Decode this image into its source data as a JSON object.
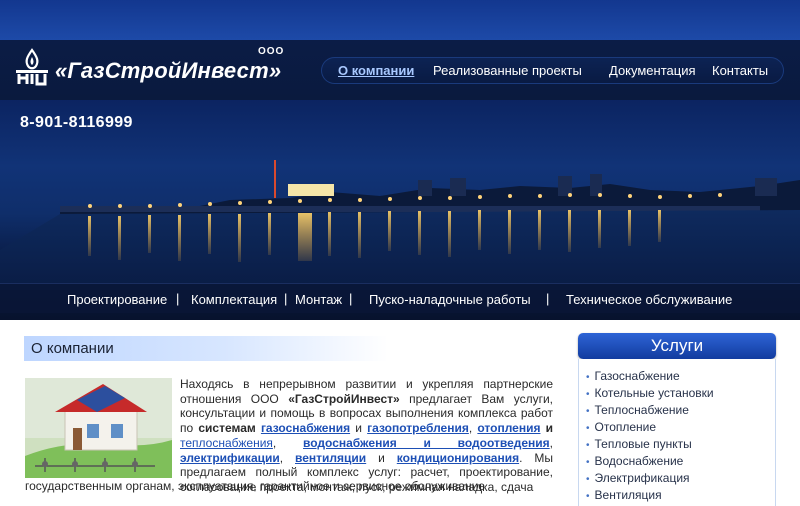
{
  "logo": {
    "text": "«ГазСтройИнвест»",
    "suffix": "ООО",
    "icon": "gas-flame-logo-icon"
  },
  "nav": [
    {
      "label": "О компании",
      "active": true
    },
    {
      "label": "Реализованные проекты",
      "active": false
    },
    {
      "label": "Документация",
      "active": false
    },
    {
      "label": "Контакты",
      "active": false
    }
  ],
  "phone": "8-901-8116999",
  "service_strip": [
    "Проектирование",
    "|",
    "Комплектация",
    "|",
    "Монтаж",
    "|",
    "Пуско-наладочные работы",
    "|",
    "Техническое обслуживание"
  ],
  "content": {
    "title": "О компании",
    "p1": "Находясь в непрерывном развитии и укрепляя партнерские отношения ООО ",
    "company": "«ГазСтройИнвест»",
    "p2": " предлагает Вам услуги, консультации и помощь в вопросах выполнения комплекса работ по ",
    "systems": "системам",
    "link_gas_supply": "газоснабжения",
    "and1": " и ",
    "link_gas_use": "газопотребления",
    "comma1": ", ",
    "link_heating": "отопления",
    "and2": " и ",
    "link_heat_supply": "теплоснабжения",
    "comma2": ", ",
    "link_water": "водоснабжения и водоотведения",
    "comma3": ", ",
    "link_electric": "электрификации",
    "comma4": ", ",
    "link_ventilation": "вентиляции",
    "and3": " и ",
    "link_conditioning": "кондиционирования",
    "p3": ". Мы предлагаем полный комплекс услуг: расчет, проектирование, согласование проекта, монтаж, пуск, режимная наладка, сдача",
    "tail": "государственным органам, эксплуатация, гарантийное и сервисное обслуживание"
  },
  "services": {
    "title": "Услуги",
    "items": [
      "Газоснабжение",
      "Котельные установки",
      "Теплоснабжение",
      "Отопление",
      "Тепловые пункты",
      "Водоснабжение",
      "Электрификация",
      "Вентиляция"
    ]
  },
  "colors": {
    "header_dark": "#0a1a3e",
    "accent_blue": "#1d4fb5",
    "services_head": "#1e4cb8"
  }
}
